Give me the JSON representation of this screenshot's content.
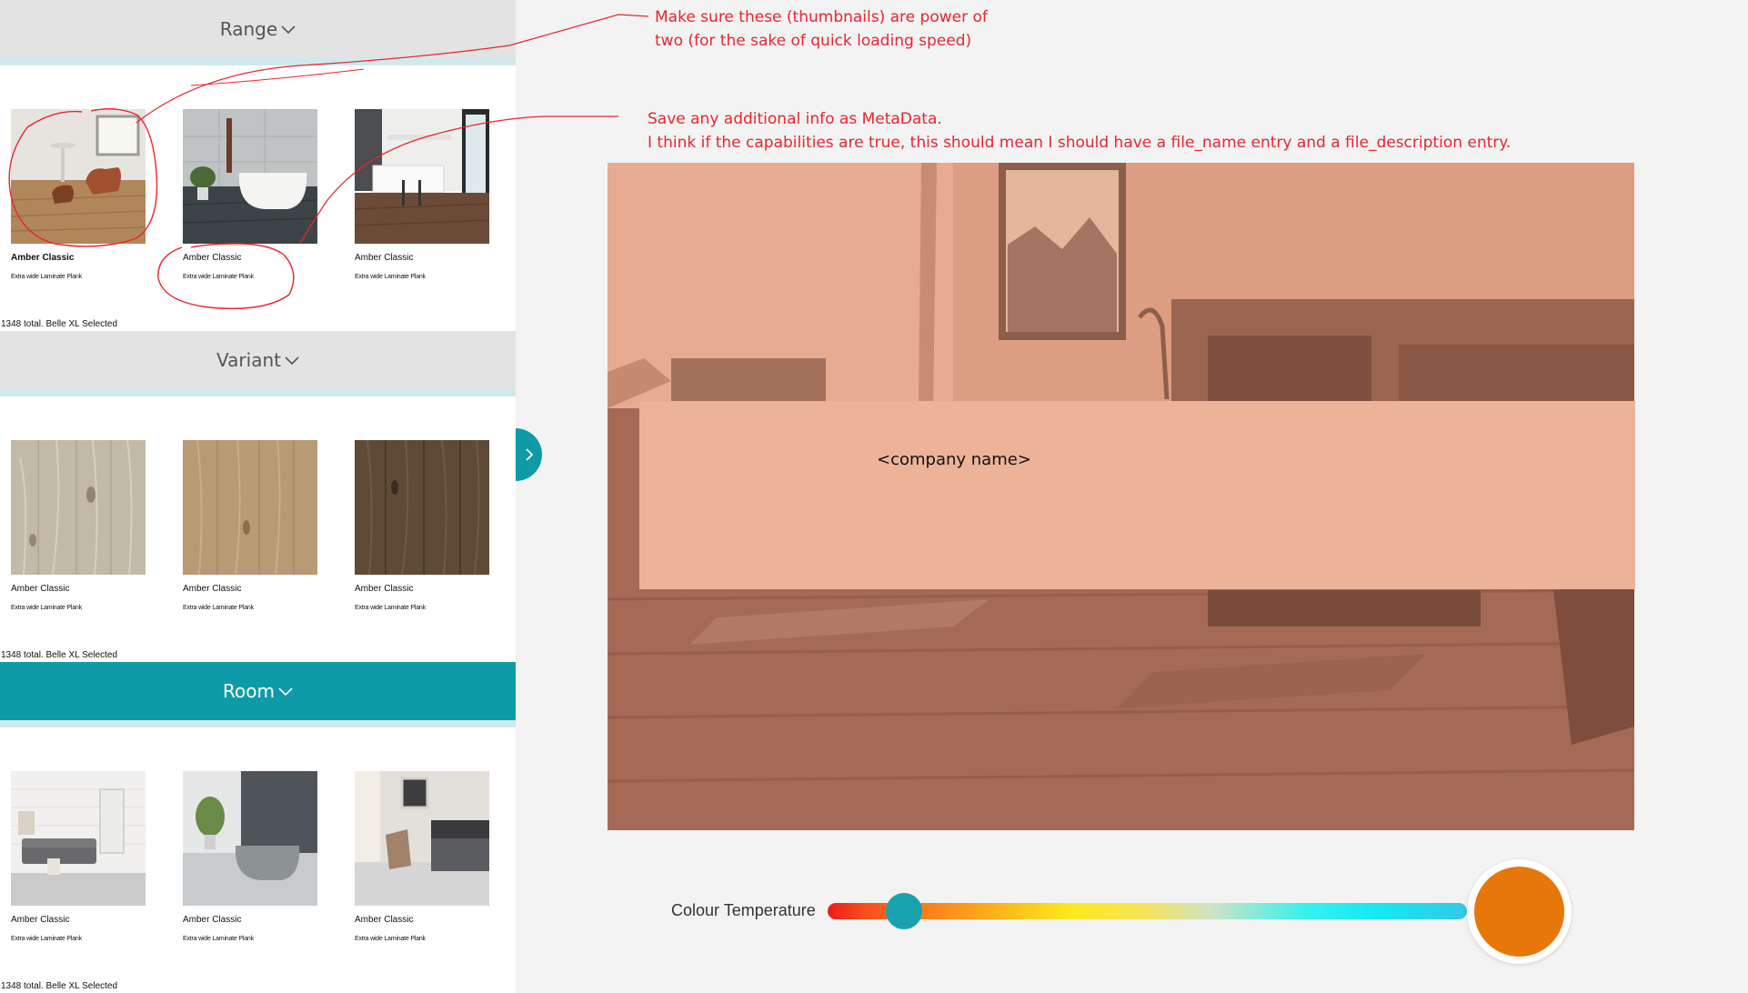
{
  "sections": [
    {
      "title": "Range",
      "active": false,
      "total_text": "1348 total. Belle XL Selected",
      "tiles": [
        {
          "name": "Amber Classic",
          "subtitle": "Extra wide Laminate Plank",
          "bold": true,
          "thumb": "living-room-scene"
        },
        {
          "name": "Amber Classic",
          "subtitle": "Extra wide Laminate Plank",
          "bold": false,
          "thumb": "bathroom-scene"
        },
        {
          "name": "Amber Classic",
          "subtitle": "Extra wide Laminate Plank",
          "bold": false,
          "thumb": "kitchen-scene"
        }
      ]
    },
    {
      "title": "Variant",
      "active": false,
      "total_text": "1348 total. Belle XL Selected",
      "tiles": [
        {
          "name": "Amber Classic",
          "subtitle": "Extra wide Laminate Plank",
          "bold": false,
          "thumb": "light-grey-oak"
        },
        {
          "name": "Amber Classic",
          "subtitle": "Extra wide Laminate Plank",
          "bold": false,
          "thumb": "natural-oak"
        },
        {
          "name": "Amber Classic",
          "subtitle": "Extra wide Laminate Plank",
          "bold": false,
          "thumb": "dark-oak"
        }
      ]
    },
    {
      "title": "Room",
      "active": true,
      "total_text": "1348 total. Belle XL Selected",
      "tiles": [
        {
          "name": "Amber Classic",
          "subtitle": "Extra wide Laminate Plank",
          "bold": false,
          "thumb": "living-room-room"
        },
        {
          "name": "Amber Classic",
          "subtitle": "Extra wide Laminate Plank",
          "bold": false,
          "thumb": "bathroom-room"
        },
        {
          "name": "Amber Classic",
          "subtitle": "Extra wide Laminate Plank",
          "bold": false,
          "thumb": "bedroom-room"
        }
      ]
    }
  ],
  "preview": {
    "company_name": "<company name>"
  },
  "colour_temperature": {
    "label": "Colour Temperature",
    "value": 0.12,
    "swatch_color": "#e8770a"
  },
  "annotations": {
    "note1_line1": "Make sure these (thumbnails) are power of",
    "note1_line2": "two (for the sake of quick loading speed)",
    "note2_line1": "Save any additional info as MetaData.",
    "note2_line2": "I think if the capabilities are true, this should mean I should have a file_name entry and a file_description entry."
  },
  "colors": {
    "accent": "#0f9aa8",
    "header_bg": "#e3e3e3",
    "annotation": "#e8262d"
  }
}
